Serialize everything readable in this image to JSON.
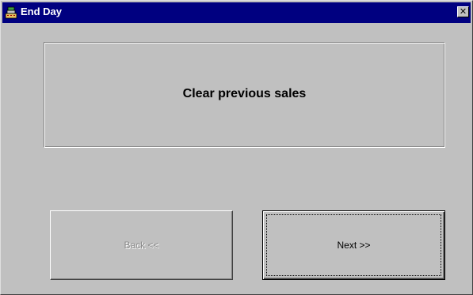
{
  "window": {
    "title": "End Day",
    "icon": "cash-register-icon",
    "close_glyph": "✕"
  },
  "message": {
    "text": "Clear previous sales"
  },
  "buttons": {
    "back_label": "Back <<",
    "back_enabled": false,
    "next_label": "Next >>",
    "next_focused": true
  },
  "colors": {
    "titlebar": "#000080",
    "face": "#c0c0c0",
    "disabled_text": "#8a8a8a"
  }
}
